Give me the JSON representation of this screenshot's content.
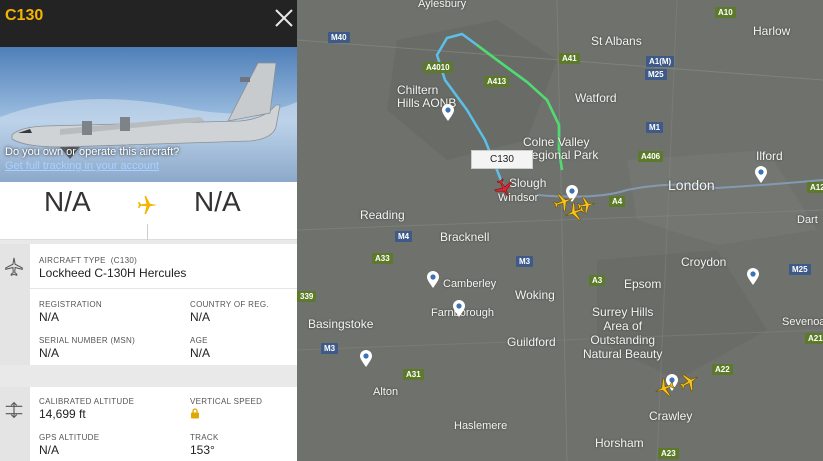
{
  "panel": {
    "callsign": "C130",
    "cta_question": "Do you own or operate this aircraft?",
    "cta_link": "Get full tracking in your account",
    "origin": "N/A",
    "destination": "N/A",
    "aircraft": {
      "type_label": "AIRCRAFT TYPE",
      "type_code": "(C130)",
      "type_value": "Lockheed C-130H Hercules",
      "registration_label": "REGISTRATION",
      "registration_value": "N/A",
      "country_label": "COUNTRY OF REG.",
      "country_value": "N/A",
      "serial_label": "SERIAL NUMBER (MSN)",
      "serial_value": "N/A",
      "age_label": "AGE",
      "age_value": "N/A"
    },
    "flight": {
      "cal_alt_label": "CALIBRATED ALTITUDE",
      "cal_alt_value": "14,699 ft",
      "vspeed_label": "VERTICAL SPEED",
      "gps_alt_label": "GPS ALTITUDE",
      "gps_alt_value": "N/A",
      "track_label": "TRACK",
      "track_value": "153°"
    }
  },
  "map": {
    "aircraft_label": "C130",
    "places": [
      {
        "key": "aylesbury",
        "text": "Aylesbury"
      },
      {
        "key": "harlow",
        "text": "Harlow"
      },
      {
        "key": "st_albans",
        "text": "St Albans"
      },
      {
        "key": "chiltern",
        "text": "Chiltern\nHills AONB"
      },
      {
        "key": "watford",
        "text": "Watford"
      },
      {
        "key": "colne",
        "text": "Colne Valley\nRegional Park"
      },
      {
        "key": "ilford",
        "text": "Ilford"
      },
      {
        "key": "slough",
        "text": "Slough"
      },
      {
        "key": "windsor",
        "text": "Windsor"
      },
      {
        "key": "london",
        "text": "London"
      },
      {
        "key": "reading",
        "text": "Reading"
      },
      {
        "key": "dart",
        "text": "Dart"
      },
      {
        "key": "bracknell",
        "text": "Bracknell"
      },
      {
        "key": "croydon",
        "text": "Croydon"
      },
      {
        "key": "camberley",
        "text": "Camberley"
      },
      {
        "key": "woking",
        "text": "Woking"
      },
      {
        "key": "epsom",
        "text": "Epsom"
      },
      {
        "key": "farnborough",
        "text": "Farnborough"
      },
      {
        "key": "basingstoke",
        "text": "Basingstoke"
      },
      {
        "key": "surrey_hills",
        "text": "Surrey Hills\nArea of\nOutstanding\nNatural Beauty"
      },
      {
        "key": "sevenoa",
        "text": "Sevenoa"
      },
      {
        "key": "guildford",
        "text": "Guildford"
      },
      {
        "key": "alton",
        "text": "Alton"
      },
      {
        "key": "crawley",
        "text": "Crawley"
      },
      {
        "key": "haslemere",
        "text": "Haslemere"
      },
      {
        "key": "horsham",
        "text": "Horsham"
      }
    ],
    "roads": [
      {
        "key": "a10",
        "text": "A10",
        "kind": "a"
      },
      {
        "key": "m40",
        "text": "M40",
        "kind": "m"
      },
      {
        "key": "a41",
        "text": "A41",
        "kind": "a"
      },
      {
        "key": "a4010",
        "text": "A4010",
        "kind": "a"
      },
      {
        "key": "a413",
        "text": "A413",
        "kind": "a"
      },
      {
        "key": "a1m",
        "text": "A1(M)",
        "kind": "m"
      },
      {
        "key": "m25a",
        "text": "M25",
        "kind": "m"
      },
      {
        "key": "m1",
        "text": "M1",
        "kind": "m"
      },
      {
        "key": "a406",
        "text": "A406",
        "kind": "a"
      },
      {
        "key": "a12",
        "text": "A12",
        "kind": "a"
      },
      {
        "key": "m4",
        "text": "M4",
        "kind": "m"
      },
      {
        "key": "a4",
        "text": "A4",
        "kind": "a"
      },
      {
        "key": "a33",
        "text": "A33",
        "kind": "a"
      },
      {
        "key": "m3a",
        "text": "M3",
        "kind": "m"
      },
      {
        "key": "a339",
        "text": "339",
        "kind": "a"
      },
      {
        "key": "a3",
        "text": "A3",
        "kind": "a"
      },
      {
        "key": "m25b",
        "text": "M25",
        "kind": "m"
      },
      {
        "key": "a21",
        "text": "A21",
        "kind": "a"
      },
      {
        "key": "m3b",
        "text": "M3",
        "kind": "m"
      },
      {
        "key": "a31",
        "text": "A31",
        "kind": "a"
      },
      {
        "key": "a22",
        "text": "A22",
        "kind": "a"
      },
      {
        "key": "a23",
        "text": "A23",
        "kind": "a"
      }
    ]
  }
}
